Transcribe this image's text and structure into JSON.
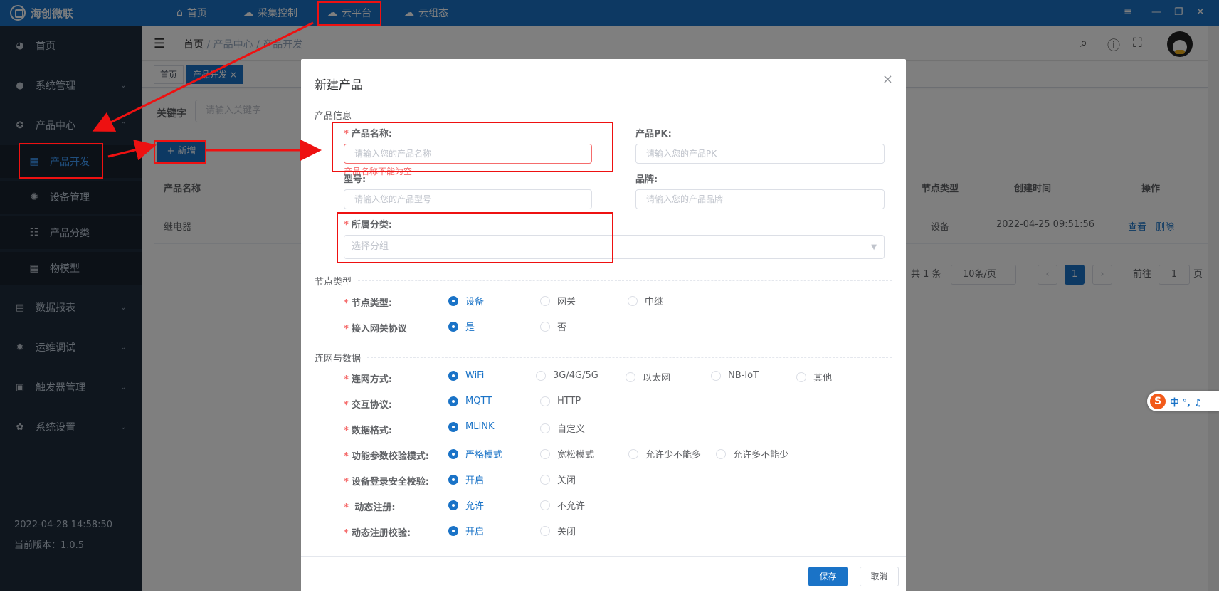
{
  "topbar": {
    "brand": "海创微联",
    "nav": [
      {
        "icon": "home-icon",
        "glyph": "⌂",
        "label": "首页"
      },
      {
        "icon": "cloud-gear-icon",
        "glyph": "☁",
        "label": "采集控制"
      },
      {
        "icon": "cloud-platform-icon",
        "glyph": "☁",
        "label": "云平台"
      },
      {
        "icon": "cloud-config-icon",
        "glyph": "☁",
        "label": "云组态"
      }
    ],
    "window_controls": [
      "≡",
      "—",
      "❐",
      "✕"
    ]
  },
  "sidebar": {
    "items": [
      {
        "label": "首页"
      },
      {
        "label": "系统管理"
      },
      {
        "label": "产品中心"
      },
      {
        "label": "数据报表"
      },
      {
        "label": "运维调试"
      },
      {
        "label": "触发器管理"
      },
      {
        "label": "系统设置"
      }
    ],
    "sub_items": [
      {
        "label": "产品开发"
      },
      {
        "label": "设备管理"
      },
      {
        "label": "产品分类"
      },
      {
        "label": "物模型"
      }
    ],
    "datetime": "2022-04-28 14:58:50",
    "version": "当前版本：1.0.5"
  },
  "header": {
    "breadcrumb": [
      "首页",
      "/",
      "产品中心",
      "/",
      "产品开发"
    ],
    "tags": [
      "首页",
      "产品开发 ×"
    ]
  },
  "list": {
    "keyword_label": "关键字",
    "keyword_placeholder": "请输入关键字",
    "add_button": "+ 新增",
    "columns": [
      "产品名称",
      "节点类型",
      "创建时间",
      "操作"
    ],
    "rows": [
      {
        "name": "继电器",
        "node_type": "设备",
        "created": "2022-04-25 09:51:56",
        "view": "查看",
        "delete": "删除"
      }
    ],
    "pager": {
      "total": "共 1 条",
      "size": "10条/页",
      "current": "1",
      "goto_label": "前往",
      "goto_value": "1",
      "page_unit": "页"
    }
  },
  "dialog": {
    "title": "新建产品",
    "close": "×",
    "section_info": "产品信息",
    "product_name_label": "产品名称:",
    "product_name_placeholder": "请输入您的产品名称",
    "product_name_error": "产品名称不能为空",
    "product_pk_label": "产品PK:",
    "product_pk_placeholder": "请输入您的产品PK",
    "model_label": "型号:",
    "model_placeholder": "请输入您的产品型号",
    "brand_label": "品牌:",
    "brand_placeholder": "请输入您的产品品牌",
    "category_label": "所属分类:",
    "category_placeholder": "选择分组",
    "section_node": "节点类型",
    "section_net": "连网与数据",
    "save": "保存",
    "cancel": "取消",
    "radio_groups": [
      {
        "label": "节点类型:",
        "options": [
          "设备",
          "网关",
          "中继"
        ],
        "selected": 0
      },
      {
        "label": "接入网关协议",
        "options": [
          "是",
          "否"
        ],
        "selected": 0
      },
      {
        "label": "连网方式:",
        "options": [
          "WiFi",
          "3G/4G/5G",
          "以太网",
          "NB-IoT",
          "其他"
        ],
        "selected": 0
      },
      {
        "label": "交互协议:",
        "options": [
          "MQTT",
          "HTTP"
        ],
        "selected": 0
      },
      {
        "label": "数据格式:",
        "options": [
          "MLINK",
          "自定义"
        ],
        "selected": 0
      },
      {
        "label": "功能参数校验模式:",
        "options": [
          "严格模式",
          "宽松模式",
          "允许少不能多",
          "允许多不能少"
        ],
        "selected": 0
      },
      {
        "label": "设备登录安全校验:",
        "options": [
          "开启",
          "关闭"
        ],
        "selected": 0
      },
      {
        "label": " 动态注册:",
        "options": [
          "允许",
          "不允许"
        ],
        "selected": 0
      },
      {
        "label": "动态注册校验:",
        "options": [
          "开启",
          "关闭"
        ],
        "selected": 0
      }
    ]
  },
  "ime": {
    "logo": "S",
    "text": "中 °, ♫"
  }
}
